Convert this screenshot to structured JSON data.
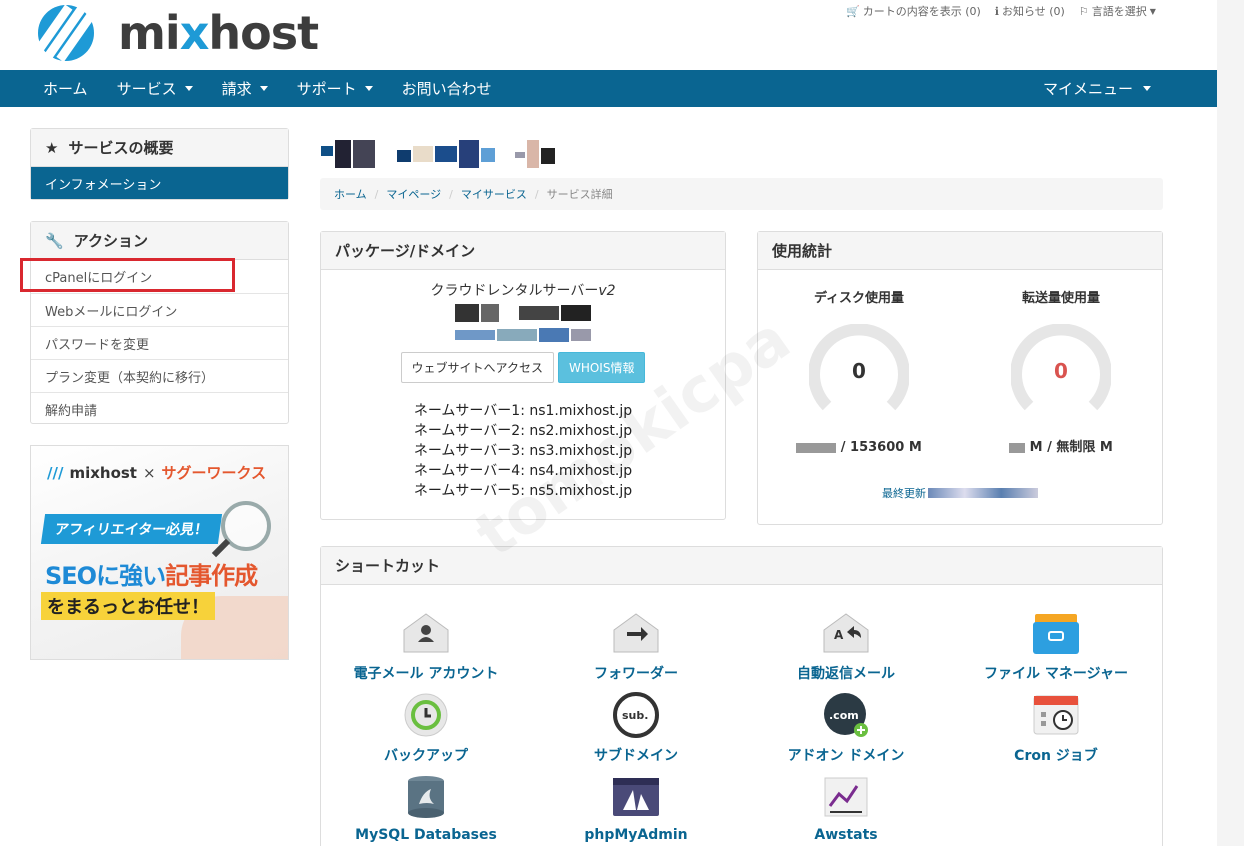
{
  "brand": {
    "logo_text_pre": "mi",
    "logo_text_x": "x",
    "logo_text_post": "host"
  },
  "topbar": {
    "cart": "カートの内容を表示 (0)",
    "notices": "お知らせ (0)",
    "language": "言語を選択"
  },
  "nav": {
    "items": [
      {
        "label": "ホーム",
        "has_caret": false
      },
      {
        "label": "サービス",
        "has_caret": true
      },
      {
        "label": "請求",
        "has_caret": true
      },
      {
        "label": "サポート",
        "has_caret": true
      },
      {
        "label": "お問い合わせ",
        "has_caret": false
      }
    ],
    "right": "マイメニュー"
  },
  "sidebar": {
    "overview_title": "サービスの概要",
    "overview_active": "インフォメーション",
    "actions_title": "アクション",
    "actions": [
      "cPanelにログイン",
      "Webメールにログイン",
      "パスワードを変更",
      "プラン変更（本契約に移行）",
      "解約申請"
    ]
  },
  "banner": {
    "brand": "mixhost",
    "x": "×",
    "partner": "サグーワークス",
    "tag": "アフィリエイター必見！",
    "headline_a": "SEOに強い",
    "headline_b": "記事作成",
    "sub": "をまるっとお任せ！"
  },
  "breadcrumb": [
    "ホーム",
    "マイページ",
    "マイサービス",
    "サービス詳細"
  ],
  "package": {
    "title": "パッケージ/ドメイン",
    "product": "クラウドレンタルサーバー",
    "version": "v2",
    "btn_site": "ウェブサイトへアクセス",
    "btn_whois": "WHOIS情報",
    "nameservers": [
      "ネームサーバー1: ns1.mixhost.jp",
      "ネームサーバー2: ns2.mixhost.jp",
      "ネームサーバー3: ns3.mixhost.jp",
      "ネームサーバー4: ns4.mixhost.jp",
      "ネームサーバー5: ns5.mixhost.jp"
    ]
  },
  "stats": {
    "title": "使用統計",
    "disk_title": "ディスク使用量",
    "transfer_title": "転送量使用量",
    "disk_value": "0",
    "transfer_value": "0",
    "disk_usage": "/ 153600 M",
    "transfer_usage": "M / 無制限 M",
    "last_updated": "最終更新"
  },
  "shortcuts": {
    "title": "ショートカット",
    "items": [
      {
        "label": "電子メール アカウント",
        "icon": "email-accounts-icon"
      },
      {
        "label": "フォワーダー",
        "icon": "forwarders-icon"
      },
      {
        "label": "自動返信メール",
        "icon": "autoresponders-icon"
      },
      {
        "label": "ファイル マネージャー",
        "icon": "file-manager-icon"
      },
      {
        "label": "バックアップ",
        "icon": "backup-icon"
      },
      {
        "label": "サブドメイン",
        "icon": "subdomains-icon"
      },
      {
        "label": "アドオン ドメイン",
        "icon": "addon-domains-icon"
      },
      {
        "label": "Cron ジョブ",
        "icon": "cron-jobs-icon"
      },
      {
        "label": "MySQL Databases",
        "icon": "mysql-icon"
      },
      {
        "label": "phpMyAdmin",
        "icon": "phpmyadmin-icon"
      },
      {
        "label": "Awstats",
        "icon": "awstats-icon"
      }
    ]
  },
  "colors": {
    "primary": "#0a6591",
    "accent": "#1e9ad6",
    "info": "#5bc0de",
    "danger_value": "#d9534f",
    "highlight": "#d9282f"
  },
  "watermark": "tomokicpa"
}
